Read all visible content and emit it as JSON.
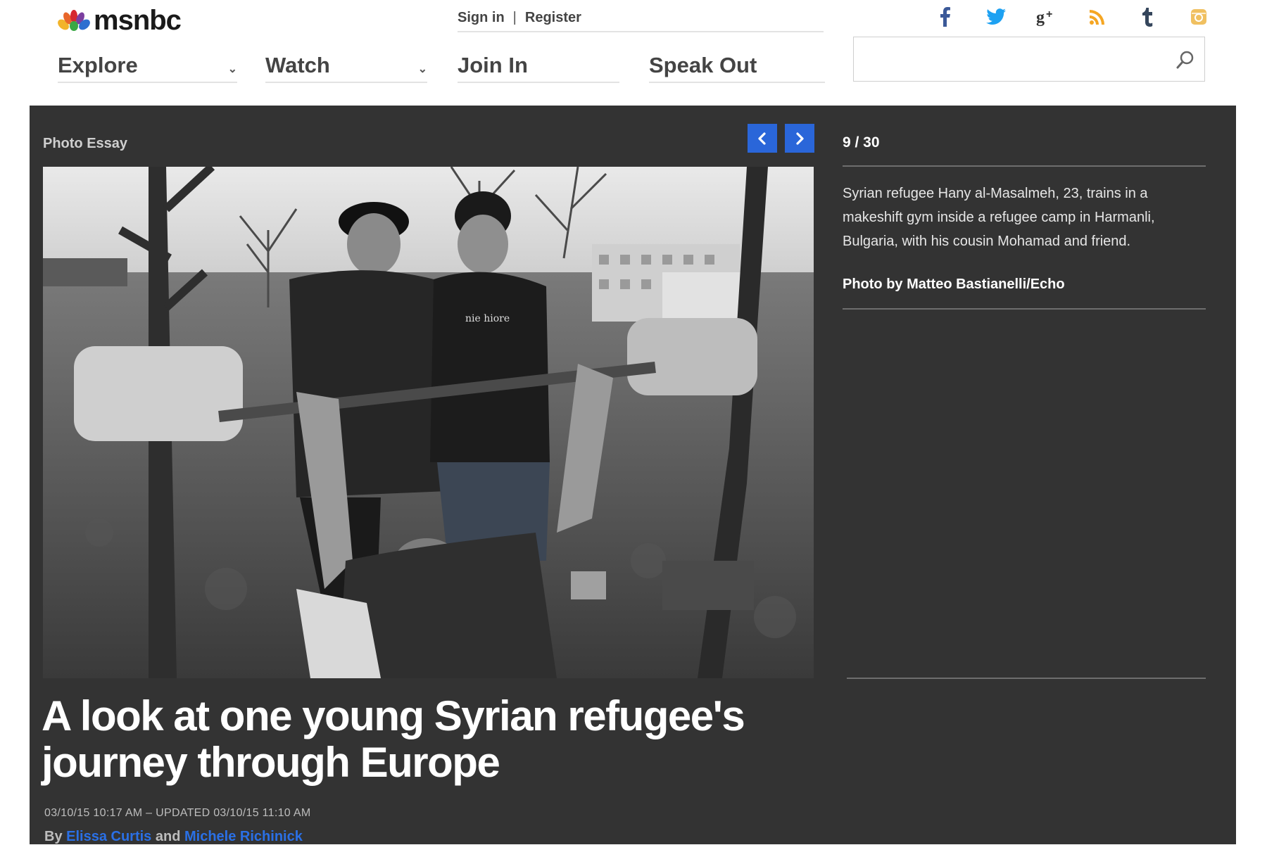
{
  "header": {
    "logo_text": "msnbc",
    "sign_in": "Sign in",
    "separator": "|",
    "register": "Register",
    "social": [
      "facebook-icon",
      "twitter-icon",
      "google-plus-icon",
      "rss-icon",
      "tumblr-icon",
      "instagram-icon"
    ],
    "search": {
      "value": "",
      "placeholder": ""
    }
  },
  "nav": [
    {
      "label": "Explore",
      "dropdown": true
    },
    {
      "label": "Watch",
      "dropdown": true
    },
    {
      "label": "Join In",
      "dropdown": false
    },
    {
      "label": "Speak Out",
      "dropdown": false
    }
  ],
  "gallery": {
    "section_label": "Photo Essay",
    "counter": "9 / 30",
    "caption": "Syrian refugee Hany al-Masalmeh, 23, trains in a makeshift gym inside a refugee camp in Harmanli, Bulgaria, with his cousin Mohamad and friend.",
    "credit": "Photo by Matteo Bastianelli/Echo",
    "photo_shirt_text": "nie hiore"
  },
  "article": {
    "headline": "A look at one young Syrian refugee's journey through Europe",
    "dateline": "03/10/15 10:17 AM – UPDATED 03/10/15 11:10 AM",
    "by": "By",
    "author1": "Elissa Curtis",
    "and": "and",
    "author2": "Michele Richinick"
  },
  "colors": {
    "panel": "#333333",
    "accent_blue": "#2a66d9",
    "link_blue": "#2a70e6",
    "facebook": "#3b5998",
    "twitter": "#1da1f2",
    "rss": "#f5a623",
    "tumblr": "#35465c",
    "instagram": "#f0c060"
  }
}
